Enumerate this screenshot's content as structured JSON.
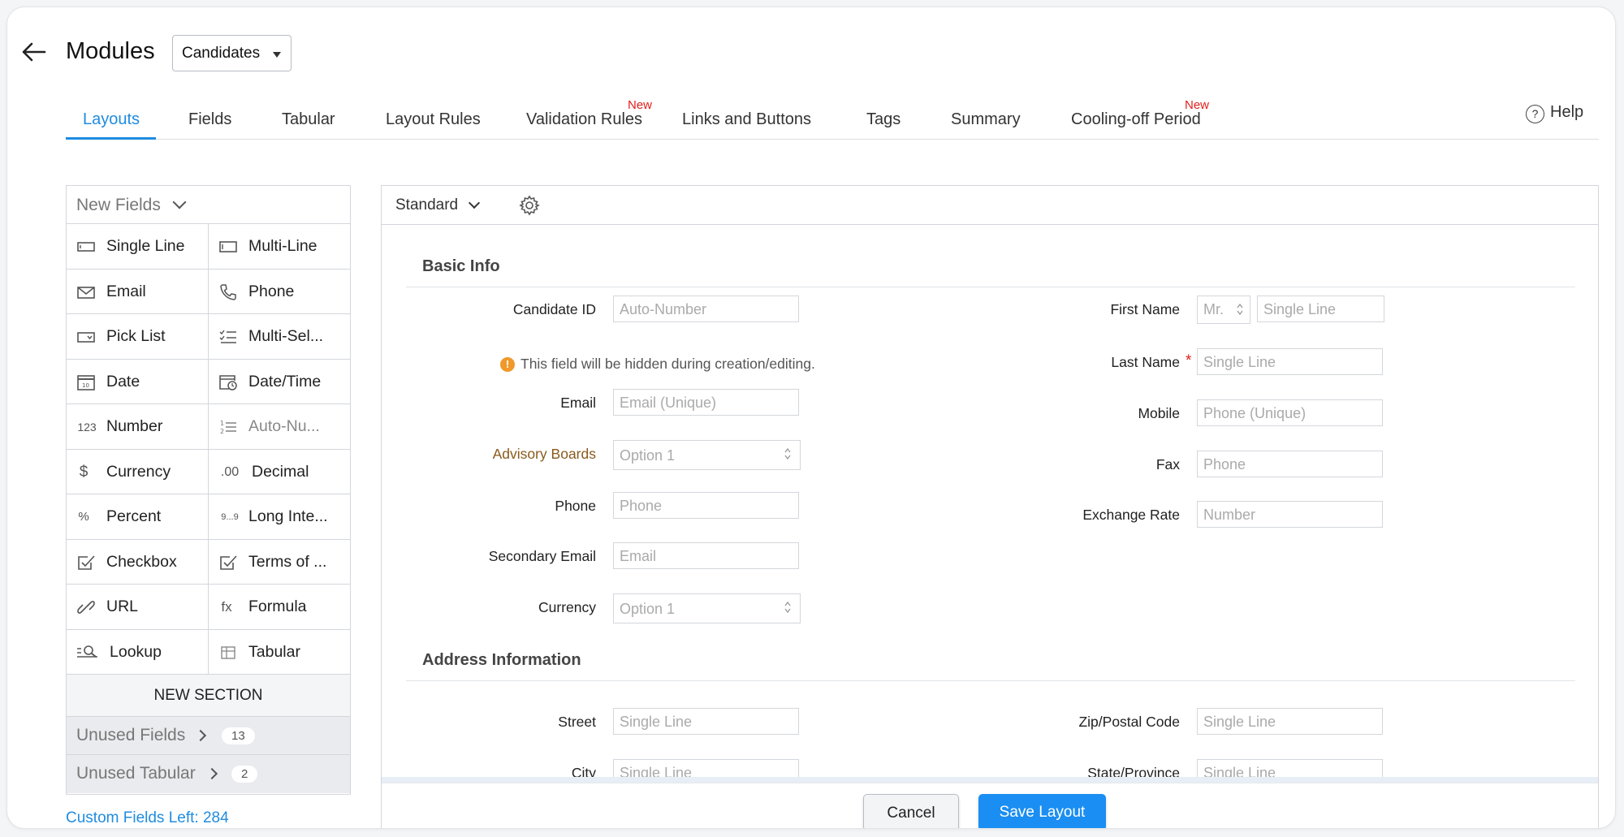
{
  "header": {
    "title": "Modules",
    "module_select": "Candidates",
    "help_label": "Help"
  },
  "tabs": [
    {
      "label": "Layouts",
      "active": true
    },
    {
      "label": "Fields"
    },
    {
      "label": "Tabular"
    },
    {
      "label": "Layout Rules"
    },
    {
      "label": "Validation Rules",
      "badge": "New"
    },
    {
      "label": "Links and Buttons"
    },
    {
      "label": "Tags"
    },
    {
      "label": "Summary"
    },
    {
      "label": "Cooling-off Period",
      "badge": "New"
    }
  ],
  "sidebar": {
    "new_fields_label": "New Fields",
    "fields": [
      {
        "label": "Single Line",
        "icon": "single-line-icon"
      },
      {
        "label": "Multi-Line",
        "icon": "multi-line-icon"
      },
      {
        "label": "Email",
        "icon": "email-icon"
      },
      {
        "label": "Phone",
        "icon": "phone-icon"
      },
      {
        "label": "Pick List",
        "icon": "picklist-icon"
      },
      {
        "label": "Multi-Sel...",
        "icon": "multi-select-icon"
      },
      {
        "label": "Date",
        "icon": "date-icon"
      },
      {
        "label": "Date/Time",
        "icon": "datetime-icon"
      },
      {
        "label": "Number",
        "icon": "number-icon"
      },
      {
        "label": "Auto-Nu...",
        "icon": "auto-number-icon"
      },
      {
        "label": "Currency",
        "icon": "currency-icon"
      },
      {
        "label": "Decimal",
        "icon": "decimal-icon"
      },
      {
        "label": "Percent",
        "icon": "percent-icon"
      },
      {
        "label": "Long Inte...",
        "icon": "long-integer-icon"
      },
      {
        "label": "Checkbox",
        "icon": "checkbox-icon"
      },
      {
        "label": "Terms of ...",
        "icon": "terms-icon"
      },
      {
        "label": "URL",
        "icon": "url-icon"
      },
      {
        "label": "Formula",
        "icon": "formula-icon"
      },
      {
        "label": "Lookup",
        "icon": "lookup-icon"
      },
      {
        "label": "Tabular",
        "icon": "tabular-icon"
      }
    ],
    "icon_glyphs": {
      "number": "123",
      "auto_number": "1—2—",
      "currency": "$",
      "decimal": ".00",
      "percent": "%",
      "long_integer": "9...9",
      "formula": "fx"
    },
    "new_section_label": "NEW SECTION",
    "unused_fields": {
      "label": "Unused Fields",
      "count": "13"
    },
    "unused_tabular": {
      "label": "Unused Tabular",
      "count": "2"
    },
    "custom_fields_left": "Custom Fields Left: 284"
  },
  "layout": {
    "layout_select": "Standard",
    "basic_info": {
      "title": "Basic Info",
      "candidate_id": {
        "label": "Candidate ID",
        "placeholder": "Auto-Number"
      },
      "hidden_notice": "This field will be hidden during creation/editing.",
      "info_glyph": "!",
      "email": {
        "label": "Email",
        "placeholder": "Email (Unique)"
      },
      "advisory_boards": {
        "label": "Advisory Boards",
        "placeholder": "Option 1"
      },
      "phone": {
        "label": "Phone",
        "placeholder": "Phone"
      },
      "secondary_email": {
        "label": "Secondary Email",
        "placeholder": "Email"
      },
      "currency": {
        "label": "Currency",
        "placeholder": "Option 1"
      },
      "first_name": {
        "label": "First Name",
        "salutation": "Mr.",
        "placeholder": "Single Line"
      },
      "last_name": {
        "label": "Last Name",
        "required_mark": "*",
        "placeholder": "Single Line"
      },
      "mobile": {
        "label": "Mobile",
        "placeholder": "Phone (Unique)"
      },
      "fax": {
        "label": "Fax",
        "placeholder": "Phone"
      },
      "exchange_rate": {
        "label": "Exchange Rate",
        "placeholder": "Number"
      }
    },
    "address_info": {
      "title": "Address Information",
      "street": {
        "label": "Street",
        "placeholder": "Single Line"
      },
      "city": {
        "label": "City",
        "placeholder": "Single Line"
      },
      "zip": {
        "label": "Zip/Postal Code",
        "placeholder": "Single Line"
      },
      "state": {
        "label": "State/Province",
        "placeholder": "Single Line"
      }
    }
  },
  "footer": {
    "cancel_label": "Cancel",
    "save_label": "Save Layout"
  },
  "colors": {
    "accent": "#1f8ce0",
    "save_button": "#1a8ef2",
    "new_badge": "#e0201b",
    "advisory_label": "#8a5a1b",
    "info_icon": "#f0992a"
  }
}
